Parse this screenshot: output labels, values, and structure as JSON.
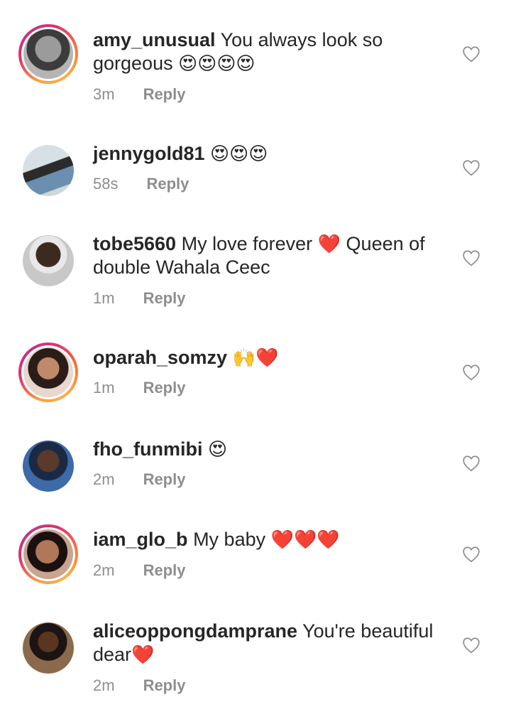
{
  "comments": [
    {
      "username": "amy_unusual",
      "text": "You always look so gorgeous",
      "emoji": "😍😍😍😍",
      "time": "3m",
      "reply": "Reply"
    },
    {
      "username": "jennygold81",
      "text": "",
      "emoji": "😍😍😍",
      "time": "58s",
      "reply": "Reply"
    },
    {
      "username": "tobe5660",
      "text": "My love forever",
      "emoji": "❤️",
      "text2": "Queen of double Wahala Ceec",
      "time": "1m",
      "reply": "Reply"
    },
    {
      "username": "oparah_somzy",
      "text": "",
      "emoji": "🙌❤️",
      "time": "1m",
      "reply": "Reply"
    },
    {
      "username": "fho_funmibi",
      "text": "",
      "emoji": "😍",
      "time": "2m",
      "reply": "Reply"
    },
    {
      "username": "iam_glo_b",
      "text": "My baby",
      "emoji": "❤️❤️❤️",
      "time": "2m",
      "reply": "Reply"
    },
    {
      "username": "aliceoppongdamprane",
      "text": "You're beautiful dear",
      "emoji": "❤️",
      "time": "2m",
      "reply": "Reply"
    }
  ],
  "colors": {
    "text": "#262626",
    "meta": "#8e8e8e",
    "heart": "#e0143c"
  }
}
